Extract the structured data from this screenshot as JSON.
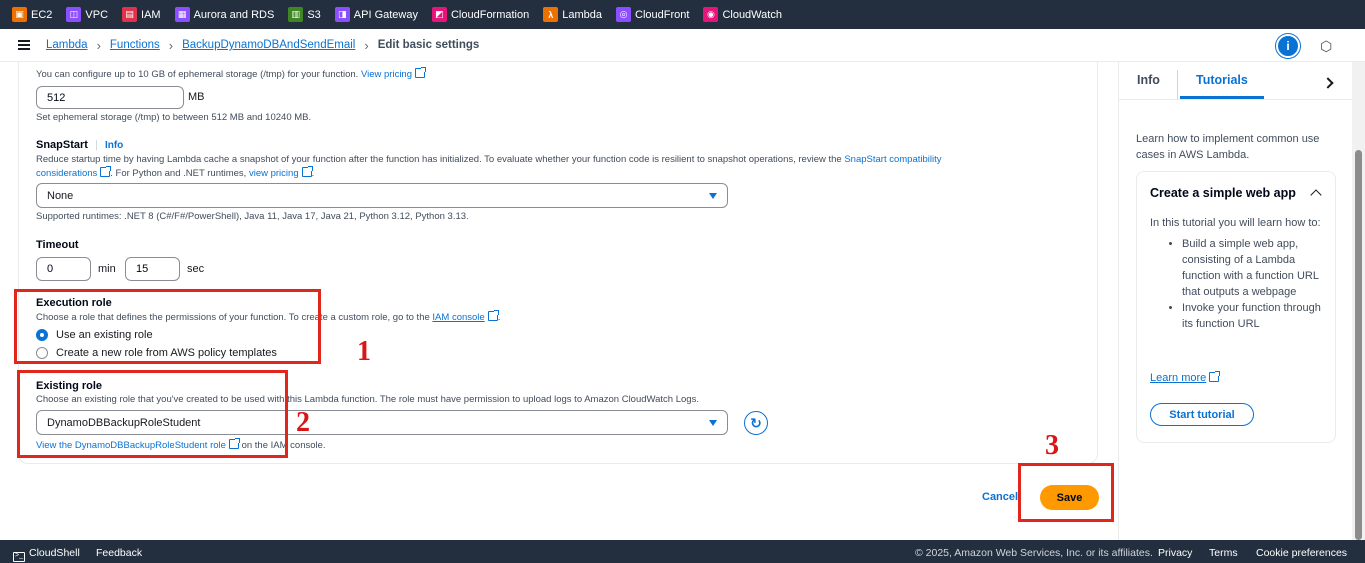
{
  "services": [
    {
      "label": "EC2",
      "color": "#ed7100",
      "icon": "ec2-icon"
    },
    {
      "label": "VPC",
      "color": "#8c4fff",
      "icon": "vpc-icon"
    },
    {
      "label": "IAM",
      "color": "#dd344c",
      "icon": "iam-icon"
    },
    {
      "label": "Aurora and RDS",
      "color": "#8c4fff",
      "icon": "rds-icon"
    },
    {
      "label": "S3",
      "color": "#3f8624",
      "icon": "s3-icon"
    },
    {
      "label": "API Gateway",
      "color": "#8c4fff",
      "icon": "api-gateway-icon"
    },
    {
      "label": "CloudFormation",
      "color": "#e7157b",
      "icon": "cloudformation-icon"
    },
    {
      "label": "Lambda",
      "color": "#ed7100",
      "icon": "lambda-icon"
    },
    {
      "label": "CloudFront",
      "color": "#8c4fff",
      "icon": "cloudfront-icon"
    },
    {
      "label": "CloudWatch",
      "color": "#e7157b",
      "icon": "cloudwatch-icon"
    }
  ],
  "breadcrumb": {
    "items": [
      "Lambda",
      "Functions",
      "BackupDynamoDBAndSendEmail"
    ],
    "current": "Edit basic settings"
  },
  "ephemeral": {
    "desc": "You can configure up to 10 GB of ephemeral storage (/tmp) for your function.",
    "link": "View pricing",
    "value": "512",
    "unit": "MB",
    "hint": "Set ephemeral storage (/tmp) to between 512 MB and 10240 MB."
  },
  "snapstart": {
    "label": "SnapStart",
    "info": "Info",
    "desc1": "Reduce startup time by having Lambda cache a snapshot of your function after the function has initialized. To evaluate whether your function code is resilient to snapshot operations, review the",
    "link1": "SnapStart compatibility",
    "link1b": "considerations",
    "desc2": ". For Python and .NET runtimes,",
    "link2": "view pricing",
    "desc3": ".",
    "selected": "None",
    "hint": "Supported runtimes: .NET 8 (C#/F#/PowerShell), Java 11, Java 17, Java 21, Python 3.12, Python 3.13."
  },
  "timeout": {
    "label": "Timeout",
    "min": "0",
    "min_unit": "min",
    "sec": "15",
    "sec_unit": "sec"
  },
  "execution_role": {
    "label": "Execution role",
    "desc": "Choose a role that defines the permissions of your function. To create a custom role, go to the",
    "link": "IAM console",
    "desc_end": ".",
    "option1": "Use an existing role",
    "option2": "Create a new role from AWS policy templates"
  },
  "existing_role": {
    "label": "Existing role",
    "desc": "Choose an existing role that you've created to be used with this Lambda function. The role must have permission to upload logs to Amazon CloudWatch Logs.",
    "selected": "DynamoDBBackupRoleStudent",
    "link": "View the DynamoDBBackupRoleStudent role",
    "link_suffix": "on the IAM console."
  },
  "annotations": [
    "1",
    "2",
    "3"
  ],
  "actions": {
    "cancel": "Cancel",
    "save": "Save"
  },
  "help": {
    "tabs": [
      "Info",
      "Tutorials"
    ],
    "desc": "Learn how to implement common use cases in AWS Lambda.",
    "card_title": "Create a simple web app",
    "card_intro": "In this tutorial you will learn how to:",
    "bullets": [
      "Build a simple web app, consisting of a Lambda function with a function URL that outputs a webpage",
      "Invoke your function through its function URL"
    ],
    "learn_more": "Learn more",
    "start": "Start tutorial"
  },
  "footer": {
    "cloudshell": "CloudShell",
    "feedback": "Feedback",
    "copyright": "© 2025, Amazon Web Services, Inc. or its affiliates.",
    "privacy": "Privacy",
    "terms": "Terms",
    "cookies": "Cookie preferences"
  }
}
